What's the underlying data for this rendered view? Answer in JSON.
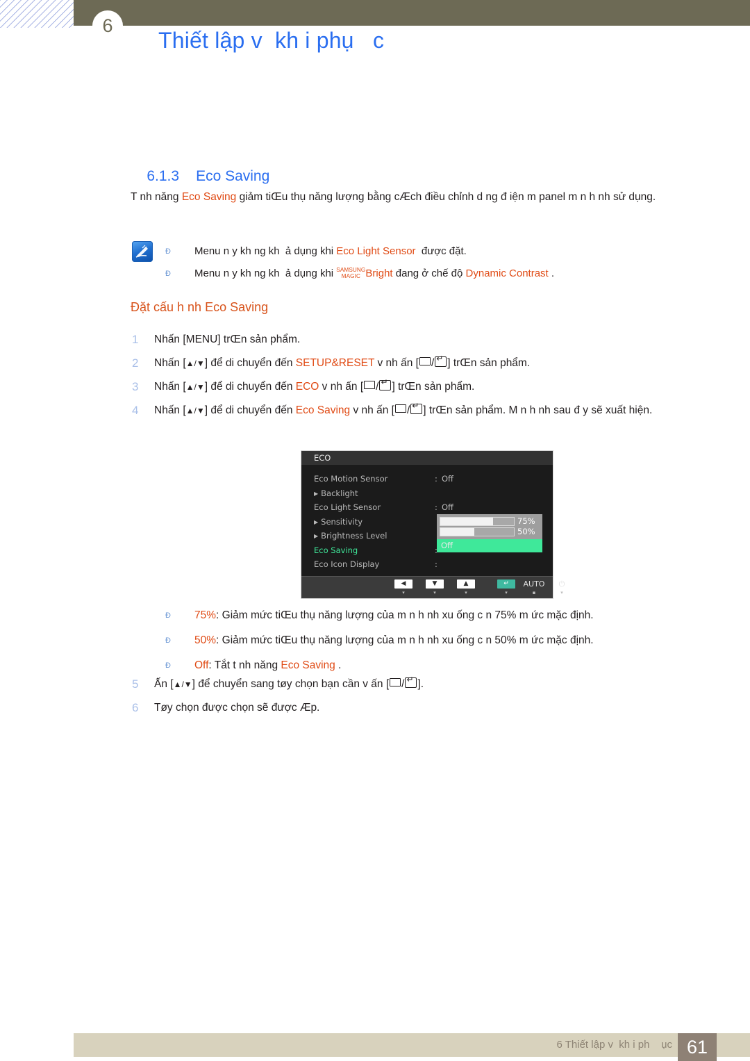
{
  "header": {
    "chapter_number": "6",
    "title": "Thiết lập v  kh i phụ   c"
  },
  "section": {
    "number": "6.1.3",
    "title": "Eco Saving"
  },
  "intro": {
    "before": "T nh năng ",
    "keyword": "Eco Saving",
    "after": " giảm tiŒu thụ năng lượng bằng cÆch điều chỉnh d ng đ iện m  panel m n h nh sử dụng."
  },
  "notes": {
    "icon": "note-pencil-icon",
    "bullet": "Ð",
    "items": [
      {
        "before": "Menu n y kh ng kh  ả dụng khi ",
        "keyword": "Eco Light Sensor",
        "after": "  được đặt."
      },
      {
        "before": "Menu n y kh ng kh  ả dụng khi ",
        "magic_top": "SAMSUNG",
        "magic_bottom": "MAGIC",
        "keyword": "Bright",
        "middle": " đang ở chế độ ",
        "keyword2": "Dynamic Contrast",
        "after": " ."
      }
    ]
  },
  "sub_heading": "Đặt cấu h nh Eco Saving",
  "steps": [
    {
      "num": "1",
      "parts": [
        {
          "t": "Nhấn [MENU] trŒn sản phẩm.",
          "c": "plain"
        }
      ]
    },
    {
      "num": "2",
      "parts": [
        {
          "t": "Nhấn [",
          "c": "plain"
        },
        {
          "t": "▲/▼",
          "c": "updn"
        },
        {
          "t": "] để di chuyển đến ",
          "c": "plain"
        },
        {
          "t": "SETUP&RESET",
          "c": "orange"
        },
        {
          "t": " v  nh ấn [",
          "c": "plain"
        },
        {
          "t": "KEYBOX",
          "c": "key"
        },
        {
          "t": "/",
          "c": "plain"
        },
        {
          "t": "KEYENT",
          "c": "key"
        },
        {
          "t": "] trŒn sản phẩm.",
          "c": "plain"
        }
      ]
    },
    {
      "num": "3",
      "parts": [
        {
          "t": "Nhấn [",
          "c": "plain"
        },
        {
          "t": "▲/▼",
          "c": "updn"
        },
        {
          "t": "] để di chuyển đến ",
          "c": "plain"
        },
        {
          "t": "ECO",
          "c": "orange"
        },
        {
          "t": " v  nh ấn [",
          "c": "plain"
        },
        {
          "t": "KEYBOX",
          "c": "key"
        },
        {
          "t": "/",
          "c": "plain"
        },
        {
          "t": "KEYENT",
          "c": "key"
        },
        {
          "t": "] trŒn sản phẩm.",
          "c": "plain"
        }
      ]
    },
    {
      "num": "4",
      "parts": [
        {
          "t": "Nhấn [",
          "c": "plain"
        },
        {
          "t": "▲/▼",
          "c": "updn"
        },
        {
          "t": "] để di chuyển đến ",
          "c": "plain"
        },
        {
          "t": "Eco Saving",
          "c": "orange"
        },
        {
          "t": "  v  nh ấn [",
          "c": "plain"
        },
        {
          "t": "KEYBOX",
          "c": "key"
        },
        {
          "t": "/",
          "c": "plain"
        },
        {
          "t": "KEYENT",
          "c": "key"
        },
        {
          "t": "] trŒn sản phẩm. M n h nh sau  đ y sẽ xuất hiện.",
          "c": "plain"
        }
      ]
    }
  ],
  "steps_tail": [
    {
      "num": "5",
      "parts": [
        {
          "t": "Ấn [",
          "c": "plain"
        },
        {
          "t": "▲/▼",
          "c": "updn"
        },
        {
          "t": "] để chuyển sang tøy chọn bạn cần v   ấn [",
          "c": "plain"
        },
        {
          "t": "KEYBOX",
          "c": "key"
        },
        {
          "t": "/",
          "c": "plain"
        },
        {
          "t": "KEYENT",
          "c": "key"
        },
        {
          "t": "].",
          "c": "plain"
        }
      ]
    },
    {
      "num": "6",
      "parts": [
        {
          "t": "Tøy chọn được chọn sẽ được Æp.",
          "c": "plain"
        }
      ]
    }
  ],
  "osd": {
    "title": "ECO",
    "rows": [
      {
        "label": "Eco Motion Sensor",
        "colon": ":",
        "value": "Off",
        "type": "item",
        "active": false
      },
      {
        "label": "Backlight",
        "colon": "",
        "value": "",
        "type": "sub",
        "active": false
      },
      {
        "label": "Eco Light Sensor",
        "colon": ":",
        "value": "Off",
        "type": "item",
        "active": false
      },
      {
        "label": "Sensitivity",
        "colon": "",
        "value": "",
        "type": "sub",
        "active": false
      },
      {
        "label": "Brightness Level",
        "colon": "",
        "value": "",
        "type": "sub",
        "active": false
      },
      {
        "label": "Eco Saving",
        "colon": ":",
        "value": "",
        "type": "item",
        "active": true
      },
      {
        "label": "Eco Icon Display",
        "colon": ":",
        "value": "",
        "type": "item",
        "active": false
      }
    ],
    "popup": {
      "bars": [
        {
          "label": "75%",
          "fill_pct": 72
        },
        {
          "label": "50%",
          "fill_pct": 46
        }
      ],
      "selected": "Off"
    },
    "footer_buttons": [
      {
        "name": "left-button",
        "glyph": "◀",
        "style": "glyph",
        "dot": "▾"
      },
      {
        "name": "down-button",
        "glyph": "▼",
        "style": "glyph",
        "dot": "▾"
      },
      {
        "name": "up-button",
        "glyph": "▲",
        "style": "glyph",
        "dot": "▾"
      },
      {
        "name": "enter-button",
        "glyph": "↵",
        "style": "teal",
        "dot": "▾"
      },
      {
        "name": "auto-button",
        "glyph": "AUTO",
        "style": "text",
        "dot": "▪"
      },
      {
        "name": "power-button",
        "glyph": "⏻",
        "style": "text",
        "dot": "▾"
      }
    ]
  },
  "options": {
    "bullet": "Ð",
    "items": [
      {
        "keyword": "75%",
        "text": ": Giảm mức tiŒu thụ năng lượng của m n h nh xu ống c n 75% m ức mặc định."
      },
      {
        "keyword": "50%",
        "text": ": Giảm mức tiŒu thụ năng lượng của m n h nh xu ống c n 50% m ức mặc định."
      },
      {
        "keyword": "Off",
        "text": ": Tắt t nh năng ",
        "keyword2": "Eco Saving",
        "tail": " ."
      }
    ]
  },
  "footer": {
    "text": "6 Thiết lập v  kh i ph    ục",
    "page": "61"
  },
  "colors": {
    "header_bar": "#6d6a55",
    "heading_blue": "#2a6ef0",
    "keyword_orange": "#e04a14",
    "step_number": "#a9bfe8",
    "osd_green": "#3fe89a",
    "footer_bar": "#d8d2bd",
    "page_box": "#8e8175"
  }
}
